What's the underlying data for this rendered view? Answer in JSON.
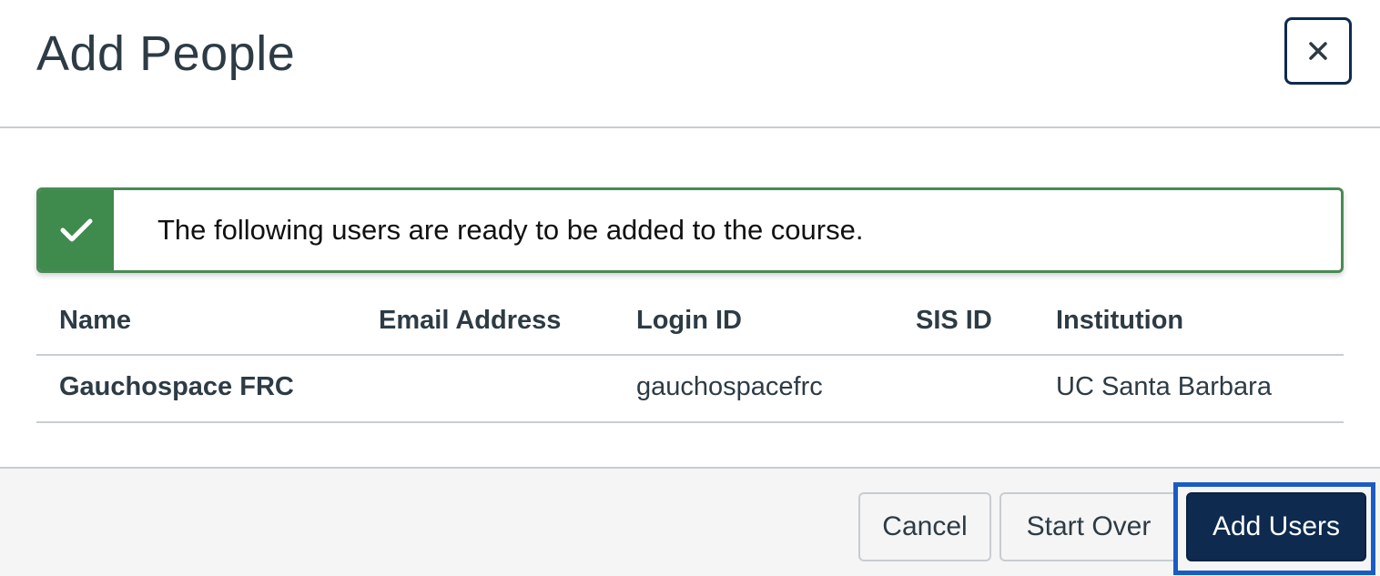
{
  "dialog": {
    "title": "Add People",
    "close_icon": "close-icon"
  },
  "alert": {
    "icon": "checkmark-icon",
    "message": "The following users are ready to be added to the course.",
    "color": "#3f8a4d"
  },
  "table": {
    "columns": [
      "Name",
      "Email Address",
      "Login ID",
      "SIS ID",
      "Institution"
    ],
    "rows": [
      {
        "name": "Gauchospace FRC",
        "email": "",
        "login_id": "gauchospacefrc",
        "sis_id": "",
        "institution": "UC Santa Barbara"
      }
    ]
  },
  "footer": {
    "cancel_label": "Cancel",
    "start_over_label": "Start Over",
    "add_users_label": "Add Users",
    "primary_color": "#0e2a4f"
  }
}
